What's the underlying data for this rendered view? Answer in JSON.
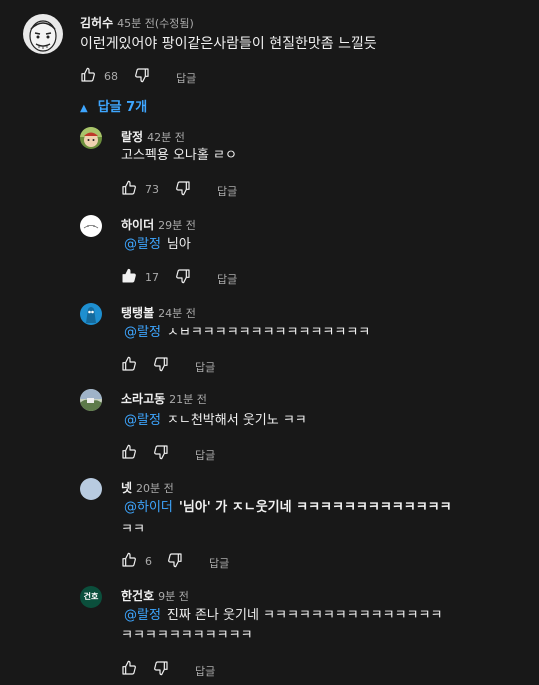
{
  "top_comment": {
    "author": "김허수",
    "time": "45분 전(수정됨)",
    "text": "이런게있어야 팡이같은사람들이 현질한맛좀 느낄듯",
    "likes": "68",
    "reply_label": "답글"
  },
  "replies_toggle": "답글 7개",
  "replies": [
    {
      "author": "랄정",
      "time": "42분 전",
      "mention": "",
      "text": "고스펙용 오나홀 ㄹㅇ",
      "text2": "",
      "likes": "73",
      "reply_label": "답글"
    },
    {
      "author": "하이더",
      "time": "29분 전",
      "mention": "@랄정",
      "text": "님아",
      "text2": "",
      "likes": "17",
      "reply_label": "답글"
    },
    {
      "author": "탱탱볼",
      "time": "24분 전",
      "mention": "@랄정",
      "text": "ㅅㅂㅋㅋㅋㅋㅋㅋㅋㅋㅋㅋㅋㅋㅋㅋㅋ",
      "text2": "",
      "likes": "",
      "reply_label": "답글"
    },
    {
      "author": "소라고동",
      "time": "21분 전",
      "mention": "@랄정",
      "text": "ㅈㄴ천박해서 웃기노 ㅋㅋ",
      "text2": "",
      "likes": "",
      "reply_label": "답글"
    },
    {
      "author": "넷",
      "time": "20분 전",
      "mention": "@하이더",
      "text": "'님아' 가 ㅈㄴ웃기네 ㅋㅋㅋㅋㅋㅋㅋㅋㅋㅋㅋㅋㅋ",
      "text2": "ㅋㅋ",
      "likes": "6",
      "reply_label": "답글"
    },
    {
      "author": "한건호",
      "time": "9분 전",
      "mention": "@랄정",
      "text": "진짜 존나 웃기네 ㅋㅋㅋㅋㅋㅋㅋㅋㅋㅋㅋㅋㅋㅋㅋ",
      "text2": "ㅋㅋㅋㅋㅋㅋㅋㅋㅋㅋㅋ",
      "likes": "",
      "reply_label": "답글"
    }
  ],
  "avatar_text_hangeonho": "건호",
  "colors": {
    "background": "#181818",
    "link": "#3ea6ff",
    "muted": "#aaaaaa",
    "text": "#f1f1f1"
  }
}
